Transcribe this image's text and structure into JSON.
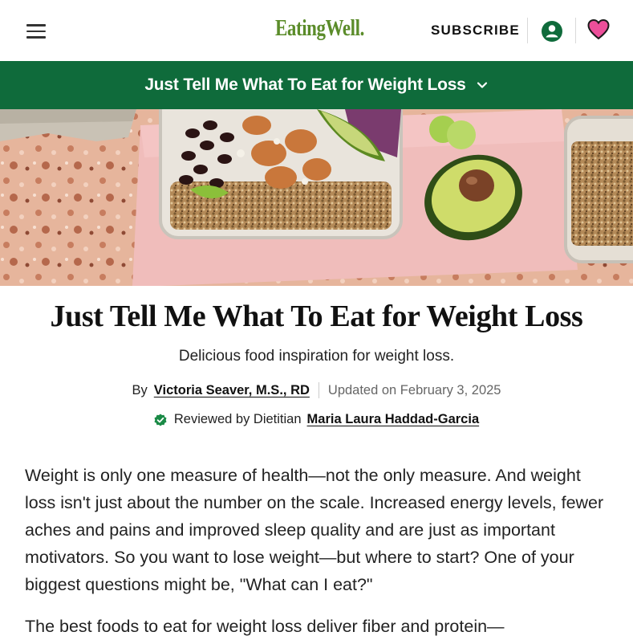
{
  "header": {
    "logo_text": "EatingWell.",
    "subscribe_label": "SUBSCRIBE",
    "icons": [
      "menu-icon",
      "account-icon",
      "heart-icon"
    ],
    "logo_color": "#5b8c2a"
  },
  "banner": {
    "title": "Just Tell Me What To Eat for Weight Loss",
    "background": "#0f6b3b"
  },
  "article": {
    "title": "Just Tell Me What To Eat for Weight Loss",
    "subtitle": "Delicious food inspiration for weight loss.",
    "by_label": "By",
    "author": "Victoria Seaver, M.S., RD",
    "updated": "Updated on February 3, 2025",
    "reviewed_label": "Reviewed by Dietitian",
    "reviewer": "Maria Laura Haddad-Garcia",
    "paragraph_1": "Weight is only one measure of health—not the only measure. And weight loss isn't just about the number on the scale. Increased energy levels, fewer aches and pains and improved sleep quality and are just as important motivators. So you want to lose weight—but where to start? One of your biggest questions might be, \"What can I eat?\"",
    "paragraph_2": "The best foods to eat for weight loss deliver fiber and protein—"
  }
}
